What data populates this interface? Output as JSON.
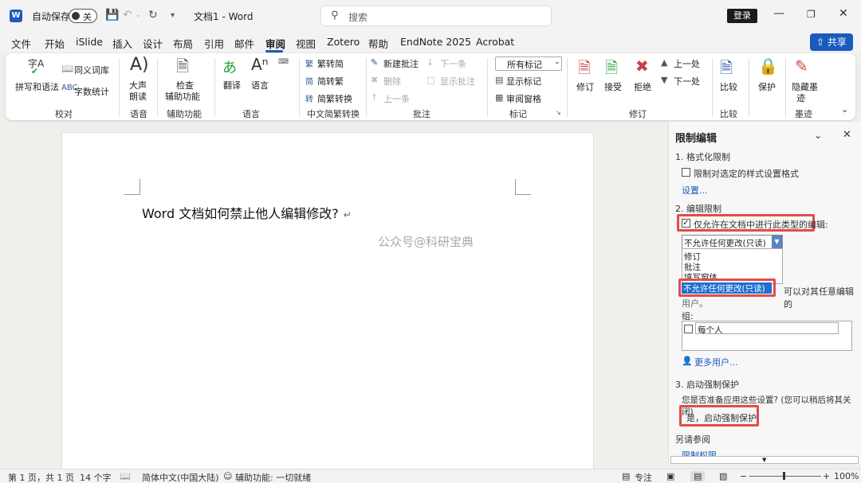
{
  "titlebar": {
    "app_icon": "W",
    "autosave_label": "自动保存",
    "autosave_state": "关",
    "doc_title": "文档1 - Word",
    "search_placeholder": "搜索",
    "login_label": "登录"
  },
  "menu": {
    "items": [
      "文件",
      "开始",
      "iSlide",
      "插入",
      "设计",
      "布局",
      "引用",
      "邮件",
      "审阅",
      "视图",
      "Zotero",
      "帮助",
      "EndNote 2025",
      "Acrobat"
    ],
    "active": "审阅",
    "share_label": "共享"
  },
  "ribbon": {
    "proofing": {
      "spelling": "拼写和语法",
      "thesaurus": "同义词库",
      "wordcount": "字数统计",
      "group": "校对",
      "spell_icon": "字A"
    },
    "speech": {
      "read_aloud_1": "大声",
      "read_aloud_2": "朗读",
      "group": "语音"
    },
    "accessibility": {
      "check_1": "检查",
      "check_2": "辅助功能",
      "group": "辅助功能"
    },
    "language": {
      "translate": "翻译",
      "language": "语言",
      "group": "语言"
    },
    "chinese": {
      "to_trad": "繁转简",
      "to_simp": "简转繁",
      "convert": "简繁转换",
      "group": "中文简繁转换"
    },
    "comments": {
      "new": "新建批注",
      "delete": "删除",
      "prev": "上一条",
      "next": "下一条",
      "show": "显示批注",
      "group": "批注"
    },
    "tracking": {
      "markup_select": "所有标记",
      "show_markup": "显示标记",
      "review_pane": "审阅窗格",
      "group": "标记"
    },
    "changes": {
      "track": "修订",
      "accept": "接受",
      "reject": "拒绝",
      "prev": "上一处",
      "next": "下一处",
      "group": "修订"
    },
    "compare": {
      "compare": "比较",
      "group": "比较"
    },
    "protect": {
      "protect": "保护"
    },
    "ink": {
      "hide_1": "隐藏墨",
      "hide_2": "迹",
      "group": "墨迹"
    }
  },
  "document": {
    "text": "Word 文档如何禁止他人编辑修改?",
    "paragraph_mark": "↵",
    "watermark": "公众号@科研宝典"
  },
  "pane": {
    "title": "限制编辑",
    "section1": "1. 格式化限制",
    "format_checkbox": "限制对选定的样式设置格式",
    "settings_link": "设置...",
    "section2": "2. 编辑限制",
    "edit_checkbox": "仅允许在文档中进行此类型的编辑:",
    "edit_checked": true,
    "dropdown_value": "不允许任何更改(只读)",
    "options": [
      "修订",
      "批注",
      "填写窗体",
      "不允许任何更改(只读)"
    ],
    "exceptions_text": "可以对其任意编辑的",
    "exceptions_text2": "用户。",
    "group_label": "组:",
    "everyone": "每个人",
    "more_users": "更多用户...",
    "section3": "3. 启动强制保护",
    "ready_text": "您是否准备应用这些设置? (您可以稍后将其关闭)",
    "start_button": "是，启动强制保护",
    "see_also": "另请参阅",
    "permissions_link": "限制权限..."
  },
  "status": {
    "page": "第 1 页，共 1 页",
    "words": "14 个字",
    "language": "简体中文(中国大陆)",
    "accessibility": "辅助功能: 一切就绪",
    "focus": "专注",
    "zoom": "100%"
  }
}
